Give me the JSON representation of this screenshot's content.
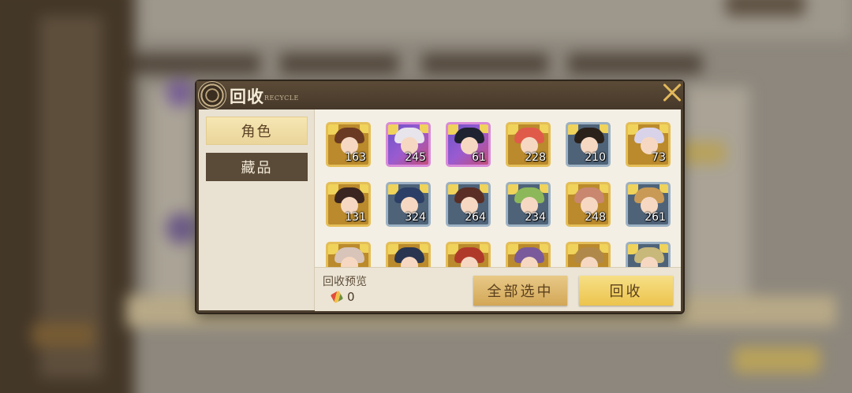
{
  "dialog": {
    "title": "回收",
    "subtitle": "RECYCLE",
    "close_icon": "close-icon"
  },
  "tabs": [
    {
      "label": "角色",
      "active": true
    },
    {
      "label": "藏品",
      "active": false
    }
  ],
  "cards": [
    {
      "count": "163",
      "rarity": "gold",
      "hair": "#6b3a22"
    },
    {
      "count": "245",
      "rarity": "purple",
      "hair": "#e8e4ec"
    },
    {
      "count": "61",
      "rarity": "purple",
      "hair": "#1f2230"
    },
    {
      "count": "228",
      "rarity": "gold",
      "hair": "#e05a4a"
    },
    {
      "count": "210",
      "rarity": "blue",
      "hair": "#2a211b"
    },
    {
      "count": "73",
      "rarity": "gold",
      "hair": "#d9d3ea"
    },
    {
      "count": "131",
      "rarity": "gold",
      "hair": "#3a2520"
    },
    {
      "count": "324",
      "rarity": "blue",
      "hair": "#2c3f66"
    },
    {
      "count": "264",
      "rarity": "blue",
      "hair": "#5a2e25"
    },
    {
      "count": "234",
      "rarity": "blue",
      "hair": "#8db85a"
    },
    {
      "count": "248",
      "rarity": "gold",
      "hair": "#c98770"
    },
    {
      "count": "261",
      "rarity": "blue",
      "hair": "#c99a55"
    },
    {
      "count": "",
      "rarity": "gold",
      "hair": "#d8c4b8"
    },
    {
      "count": "",
      "rarity": "gold",
      "hair": "#2a3550"
    },
    {
      "count": "",
      "rarity": "gold",
      "hair": "#b03a2a"
    },
    {
      "count": "",
      "rarity": "gold",
      "hair": "#7a5a9a"
    },
    {
      "count": "",
      "rarity": "gold",
      "hair": "#b0894a"
    },
    {
      "count": "",
      "rarity": "blue",
      "hair": "#c8b87a"
    }
  ],
  "footer": {
    "preview_label": "回收预览",
    "preview_icon": "gem-icon",
    "preview_value": "0",
    "select_all_label": "全部选中",
    "recycle_label": "回收"
  },
  "colors": {
    "gold_frame": "#e4be58",
    "purple_frame": "#d98ad8",
    "blue_frame": "#9cb1c4",
    "accent": "#ecc44d"
  }
}
